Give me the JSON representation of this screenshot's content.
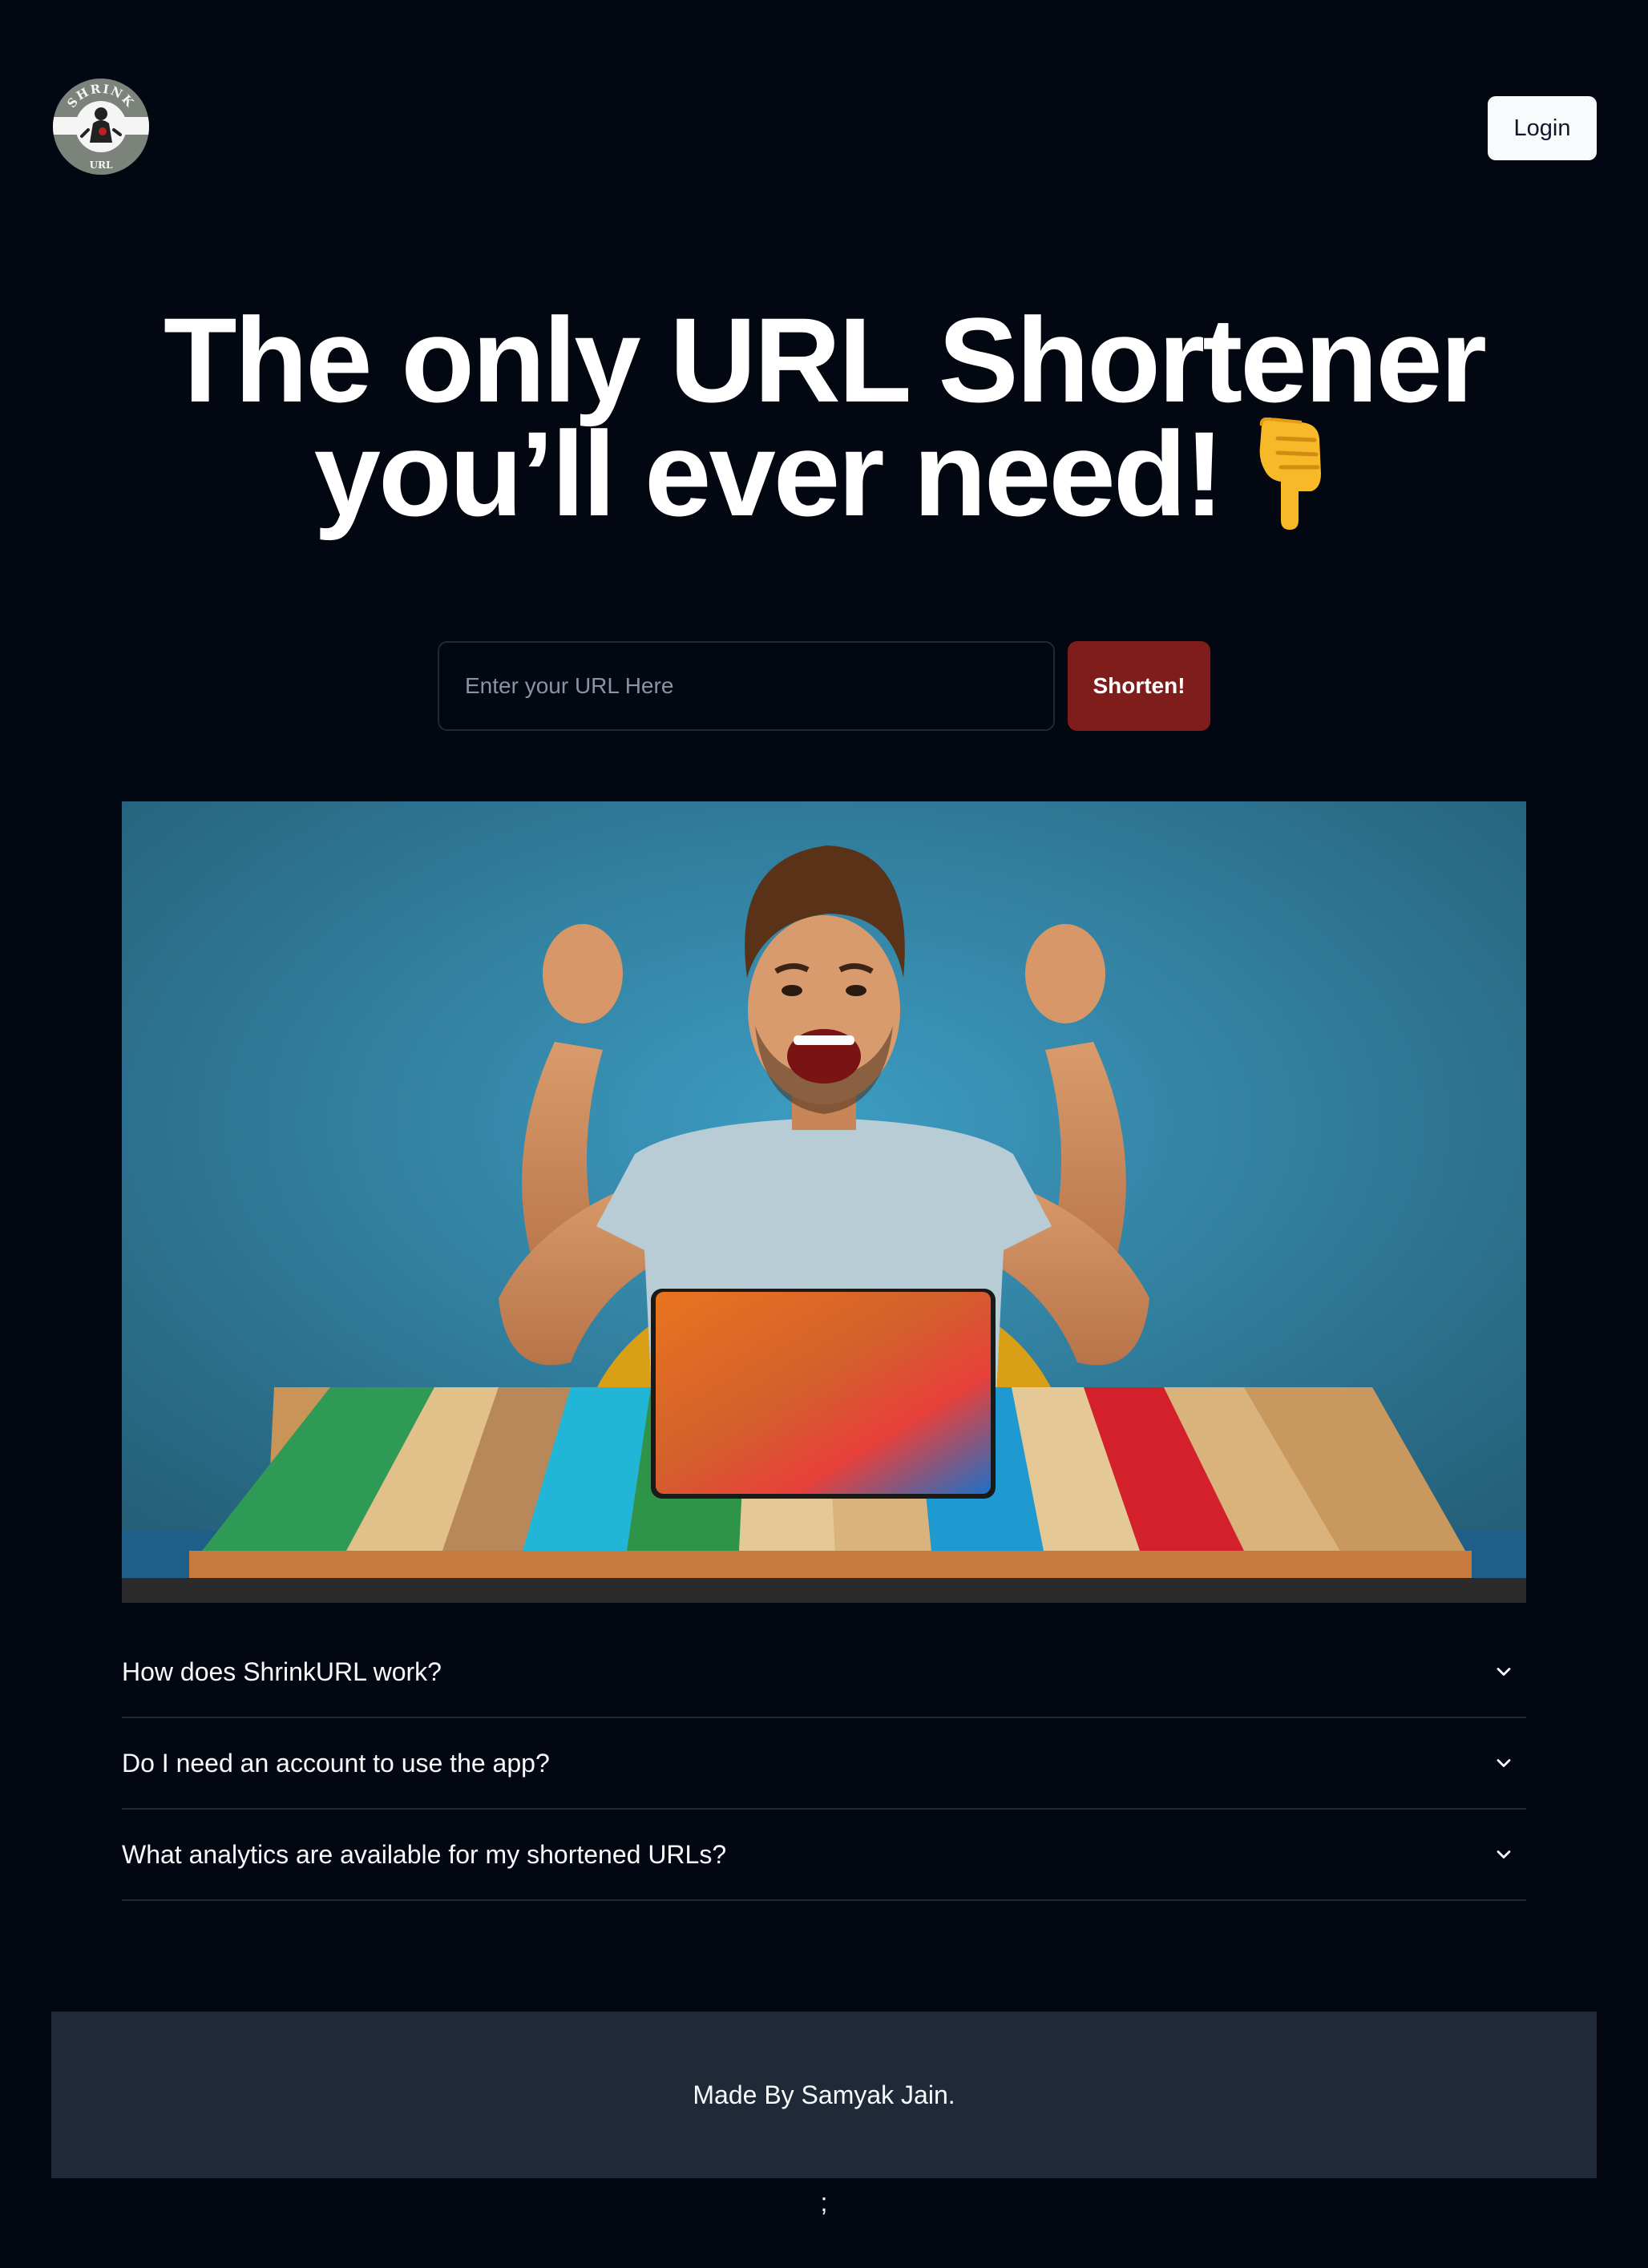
{
  "header": {
    "logo": {
      "top_text": "SHRINK",
      "bottom_text": "URL",
      "icon": "ninja-logo"
    },
    "login_label": "Login"
  },
  "hero": {
    "title_line1": "The only URL Shortener",
    "title_line2": "you’ll ever need!",
    "title_icon": "pointing-down-hand-icon"
  },
  "form": {
    "url_placeholder": "Enter your URL Here",
    "url_value": "",
    "submit_label": "Shorten!"
  },
  "banner": {
    "description_icon": "excited-man-at-laptop-illustration"
  },
  "faq": {
    "items": [
      {
        "question": "How does ShrinkURL work?"
      },
      {
        "question": "Do I need an account to use the app?"
      },
      {
        "question": "What analytics are available for my shortened URLs?"
      }
    ]
  },
  "footer": {
    "text": "Made By Samyak Jain.",
    "trailing_text": ";"
  },
  "colors": {
    "background": "#030712",
    "primary_button": "#7f1d1d",
    "footer_bg": "#1f2937",
    "divider": "#1f2937",
    "text": "#f8fafc"
  }
}
